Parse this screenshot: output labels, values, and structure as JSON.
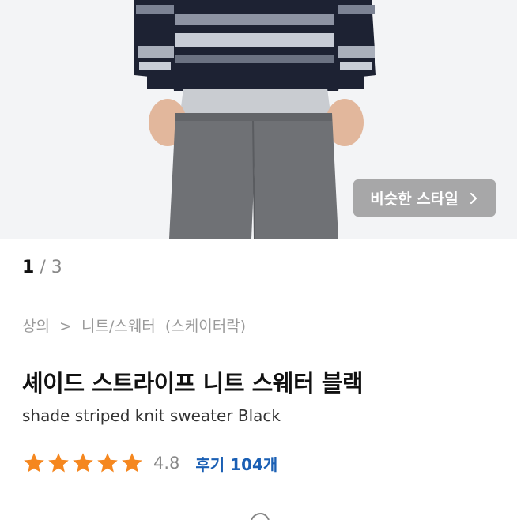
{
  "hero": {
    "image_description_icon": "product-photo",
    "similar_style_button": {
      "label": "비슷한 스타일",
      "icon": "chevron-right-icon"
    }
  },
  "pager": {
    "current": "1",
    "separator": "/",
    "total": "3"
  },
  "breadcrumb": {
    "category": "상의",
    "separator": ">",
    "subcategory": "니트/스웨터",
    "brand": "(스케이터락)"
  },
  "product": {
    "name_ko": "셰이드 스트라이프 니트 스웨터 블랙",
    "name_en": "shade striped knit sweater Black"
  },
  "rating": {
    "stars_filled": 5,
    "stars_total": 5,
    "score": "4.8",
    "reviews_label": "후기 104개",
    "star_color": "#f5871f"
  }
}
